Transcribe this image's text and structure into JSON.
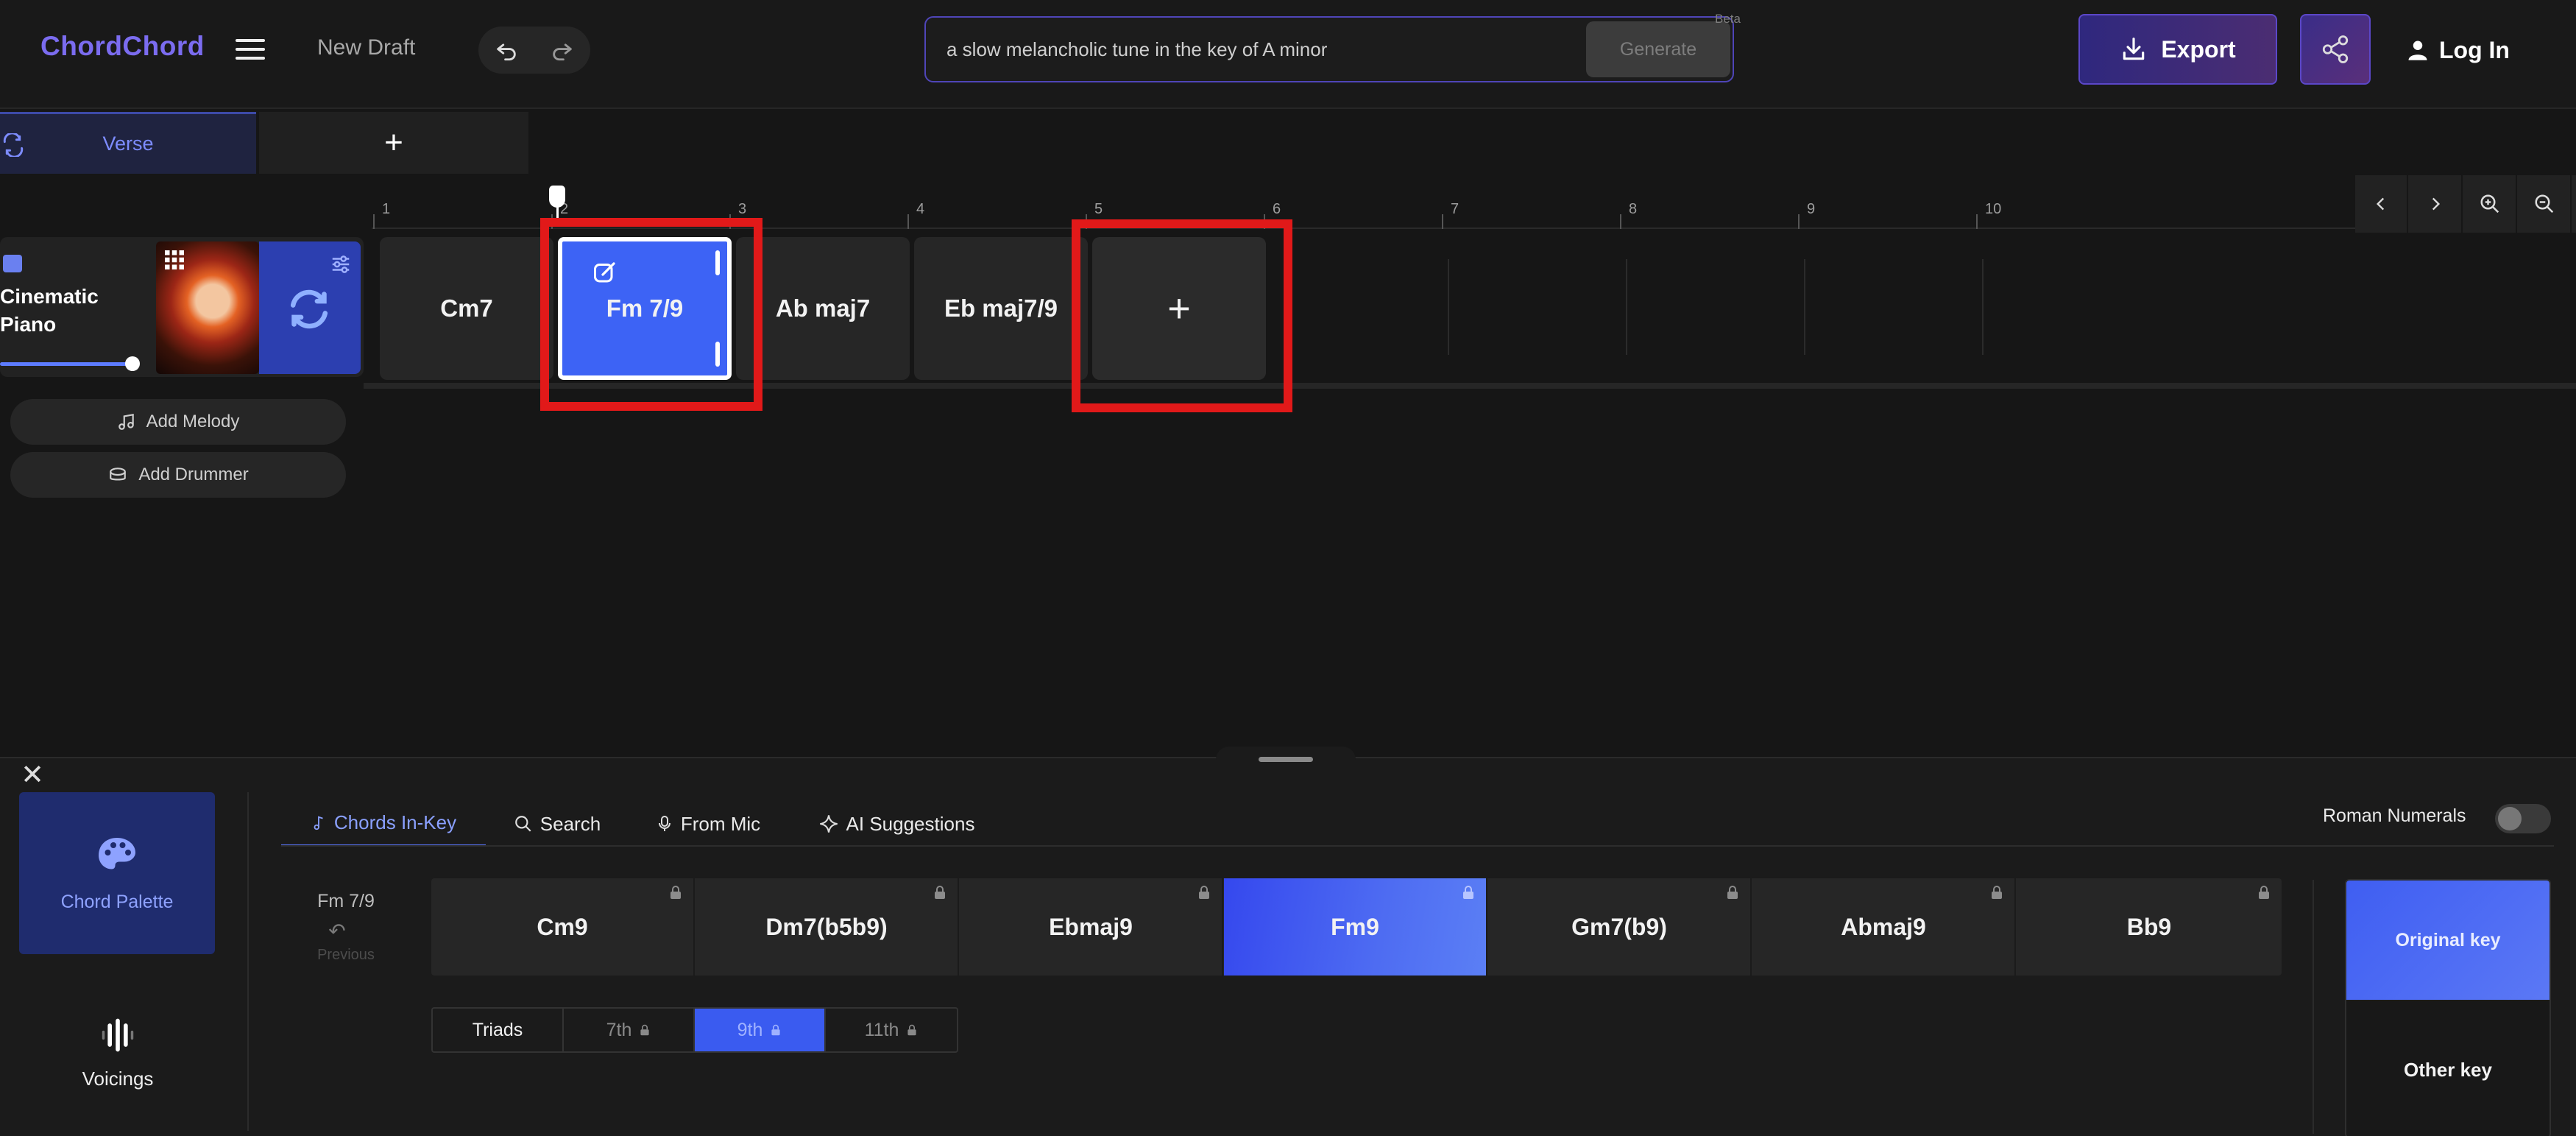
{
  "header": {
    "logo": "ChordChord",
    "draft_title": "New Draft",
    "prompt_text": "a slow melancholic tune in the key of A minor",
    "generate_label": "Generate",
    "beta_label": "Beta",
    "export_label": "Export",
    "login_label": "Log In"
  },
  "sections": {
    "active": "Verse",
    "add": "+"
  },
  "ruler": {
    "bars": [
      "1",
      "2",
      "3",
      "4",
      "5",
      "6",
      "7",
      "8",
      "9",
      "10"
    ]
  },
  "track": {
    "name_line1": "Cinematic",
    "name_line2": "Piano",
    "chords": [
      "Cm7",
      "Fm 7/9",
      "Ab maj7",
      "Eb maj7/9"
    ],
    "add_chord": "+"
  },
  "actions": {
    "add_melody": "Add Melody",
    "add_drummer": "Add Drummer"
  },
  "bottom": {
    "chord_palette": "Chord Palette",
    "voicings": "Voicings",
    "tabs": [
      "Chords In-Key",
      "Search",
      "From Mic",
      "AI Suggestions"
    ],
    "roman_numerals": "Roman Numerals",
    "previous_chord": "Fm 7/9",
    "previous_label": "Previous",
    "palette_chords": [
      "Cm9",
      "Dm7(b5b9)",
      "Ebmaj9",
      "Fm9",
      "Gm7(b9)",
      "Abmaj9",
      "Bb9"
    ],
    "selected_chord": "Fm9",
    "extensions": [
      "Triads",
      "7th",
      "9th",
      "11th"
    ],
    "selected_extension": "9th",
    "original_key": "Original key",
    "other_key": "Other key"
  },
  "colors": {
    "accent": "#3d63f5",
    "logo": "#7b6cf0",
    "highlight_box": "#e11919",
    "background": "#161616"
  }
}
